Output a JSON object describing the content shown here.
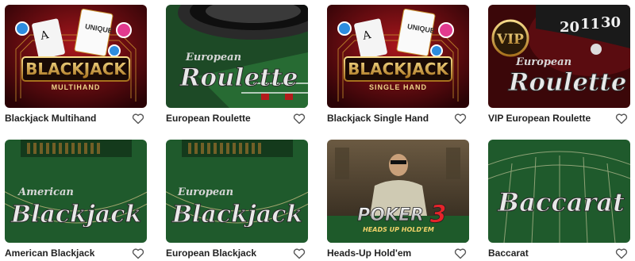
{
  "games": [
    {
      "title": "Blackjack Multihand",
      "art_main": "BLACKJACK",
      "art_sub": "MULTIHAND",
      "brand": "UNIQUE"
    },
    {
      "title": "European Roulette",
      "art_top": "European",
      "art_main": "Roulette"
    },
    {
      "title": "Blackjack Single Hand",
      "art_main": "BLACKJACK",
      "art_sub": "SINGLE HAND",
      "brand": "UNIQUE"
    },
    {
      "title": "VIP European Roulette",
      "art_badge": "VIP",
      "art_top": "European",
      "art_main": "Roulette",
      "wheel_numbers": [
        "20",
        "11",
        "30"
      ]
    },
    {
      "title": "American Blackjack",
      "art_top": "American",
      "art_main": "Blackjack"
    },
    {
      "title": "European Blackjack",
      "art_top": "European",
      "art_main": "Blackjack"
    },
    {
      "title": "Heads-Up Hold'em",
      "art_main": "POKER",
      "art_num": "3",
      "art_sub": "HEADS UP HOLD'EM"
    },
    {
      "title": "Baccarat",
      "art_main": "Baccarat"
    }
  ],
  "icons": {
    "favorite": "heart-outline-icon"
  },
  "colors": {
    "felt": "#1f5a2c",
    "gold": "#d9a53a",
    "wine": "#5a0c10",
    "title_text": "#222222"
  }
}
